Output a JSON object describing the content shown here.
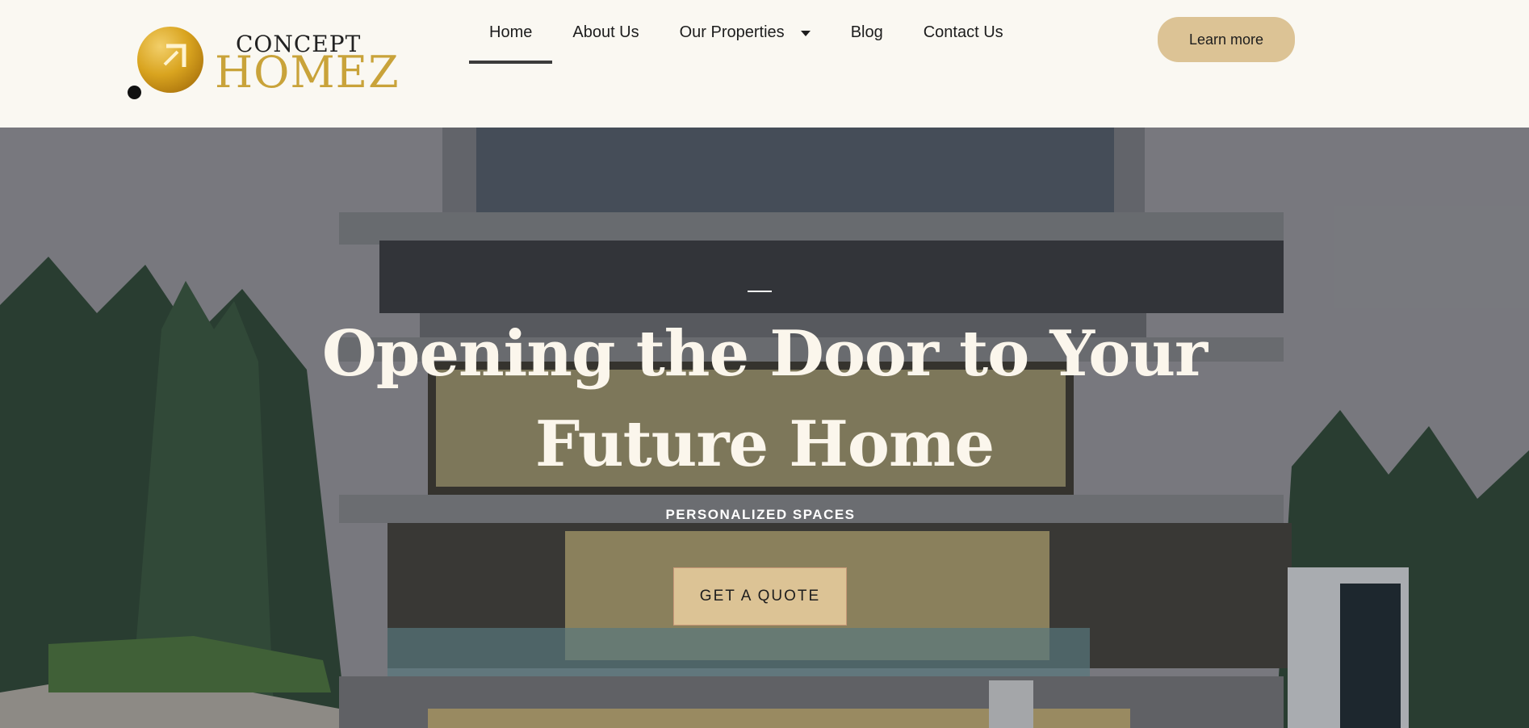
{
  "brand": {
    "top": "CONCEPT",
    "main": "HOMEZ",
    "logo_icon": "golden-sphere-logo-icon"
  },
  "nav": {
    "items": [
      {
        "label": "Home",
        "active": true
      },
      {
        "label": "About Us",
        "active": false
      },
      {
        "label": "Our Properties",
        "active": false,
        "has_dropdown": true
      },
      {
        "label": "Blog",
        "active": false
      },
      {
        "label": "Contact Us",
        "active": false
      }
    ],
    "dropdown_icon": "caret-down-icon"
  },
  "header": {
    "cta_label": "Learn more"
  },
  "hero": {
    "title_line1": "Opening the Door to Your",
    "title_line2": "Future Home",
    "subtitle": "PERSONALIZED SPACES",
    "cta_label": "GET A QUOTE"
  },
  "colors": {
    "page_bg": "#faf8f2",
    "accent": "#dcc395",
    "gold": "#c9a33a",
    "text_dark": "#1d1d1d",
    "hero_text": "#fbf6ec"
  }
}
